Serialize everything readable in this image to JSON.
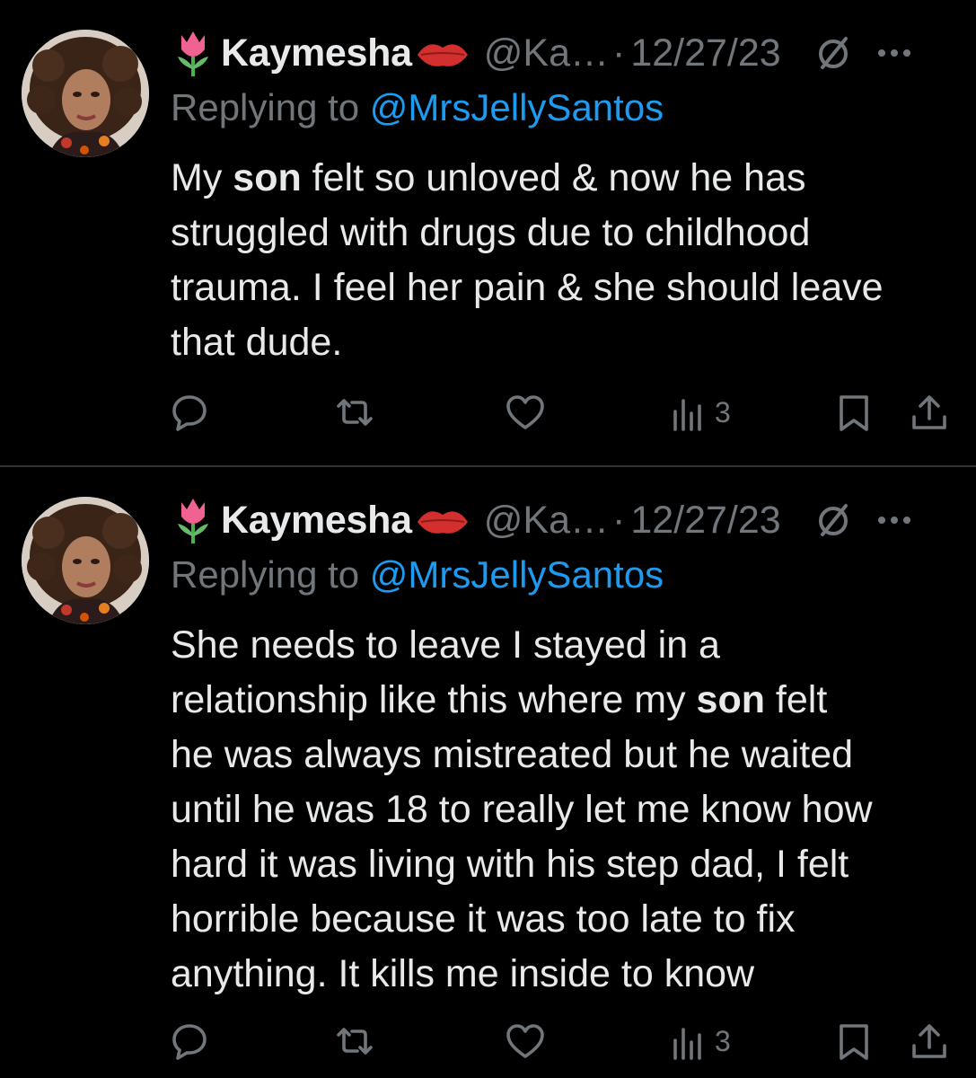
{
  "tweets": [
    {
      "author": {
        "name": "Kaymesha",
        "handle": "@Ka…",
        "separator": "·",
        "date": "12/27/23"
      },
      "reply": {
        "prefix": "Replying to ",
        "handle": "@MrsJellySantos"
      },
      "lines": [
        [
          "My ",
          "son",
          " felt so unloved & now he has"
        ],
        [
          "struggled with drugs due to childhood"
        ],
        [
          "trauma. I feel her pain & she should leave"
        ],
        [
          "that dude."
        ]
      ],
      "views": "3"
    },
    {
      "author": {
        "name": "Kaymesha",
        "handle": "@Ka…",
        "separator": "·",
        "date": "12/27/23"
      },
      "reply": {
        "prefix": "Replying to ",
        "handle": "@MrsJellySantos"
      },
      "lines": [
        [
          "She needs to leave I stayed in a"
        ],
        [
          "relationship like this where my ",
          "son",
          " felt"
        ],
        [
          "he was always mistreated but he waited"
        ],
        [
          "until he was 18 to really let me know how"
        ],
        [
          "hard it was living with his step dad, I felt"
        ],
        [
          "horrible because it was too late to fix"
        ],
        [
          "anything. It kills me inside to know"
        ]
      ],
      "views": "3"
    }
  ],
  "icons": {
    "leading_emoji": "tulip-emoji",
    "trailing_emoji": "kiss-mark-emoji",
    "status": "no-entry-circle-icon",
    "more": "more-icon",
    "actions": [
      "reply-icon",
      "retweet-icon",
      "like-icon",
      "views-icon",
      "bookmark-icon",
      "share-icon"
    ]
  },
  "colors": {
    "background": "#000000",
    "text": "#e7e9ea",
    "muted": "#71767b",
    "link": "#1d9bf0",
    "divider": "#2f3336"
  }
}
